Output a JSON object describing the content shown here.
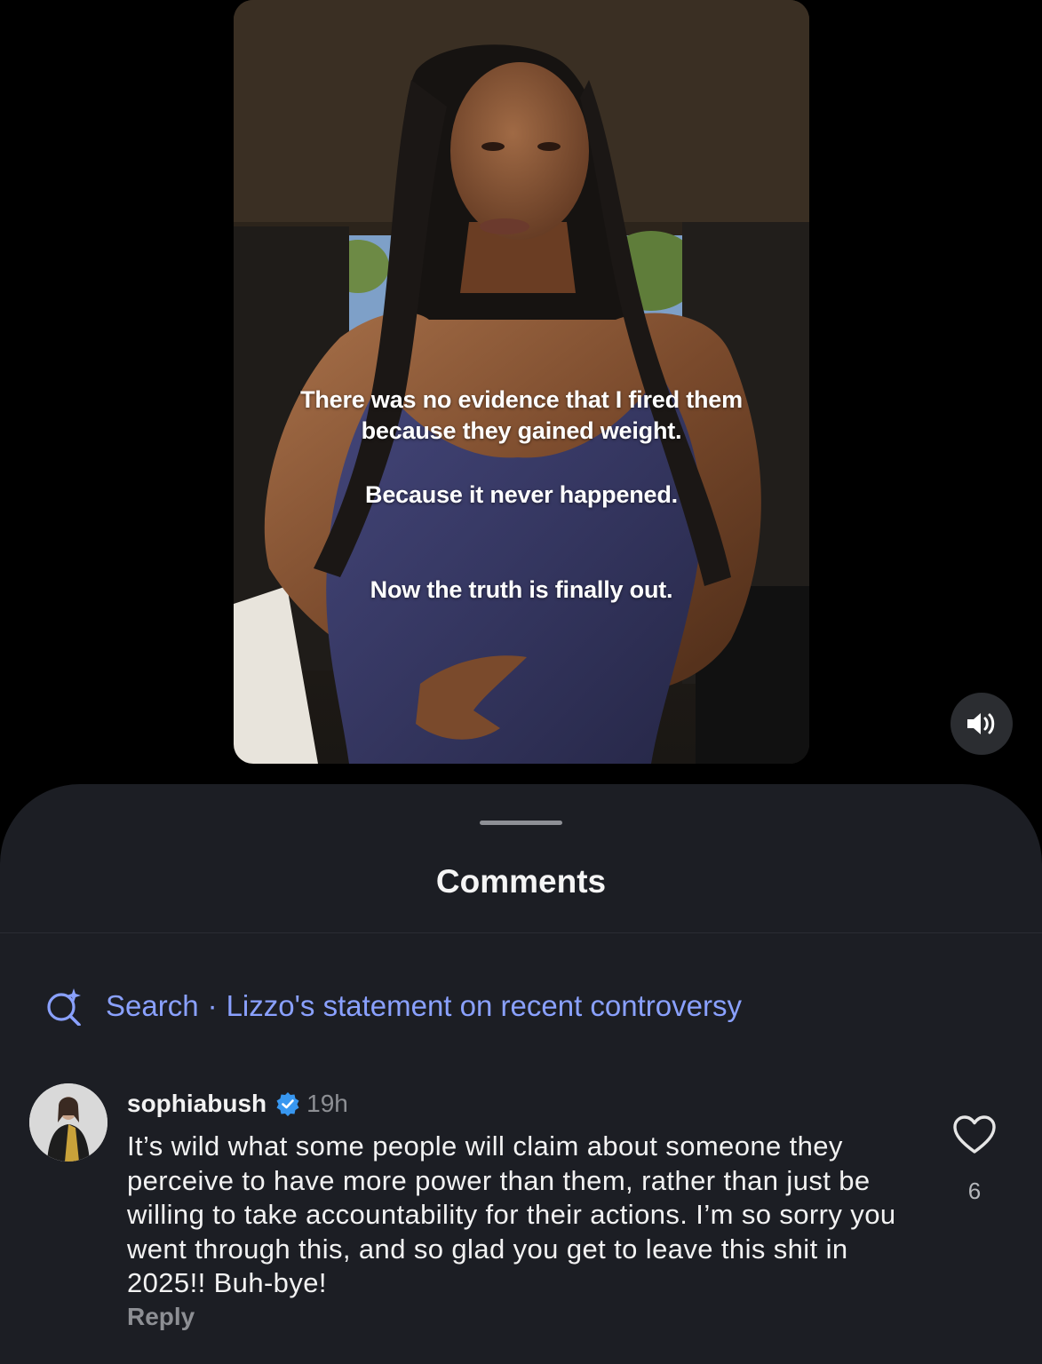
{
  "video": {
    "captions": {
      "line_1": "There was no evidence that I fired them",
      "line_2": "because they gained weight.",
      "line_3": "Because it never happened.",
      "line_4": "Now the truth is finally out."
    },
    "volume_icon": "speaker-on-icon"
  },
  "comments_sheet": {
    "title": "Comments",
    "search": {
      "icon": "search-sparkle-icon",
      "label": "Search",
      "separator": "·",
      "query": "Lizzo's statement on recent controversy"
    },
    "comment": {
      "username": "sophiabush",
      "verified": true,
      "timestamp": "19h",
      "text": "It’s wild what some people will claim about someone they perceive to have more power than them, rather than just be willing to take accountability for their actions. I’m so sorry you went through this, and so glad you get to leave this shit in 2025!! Buh-bye!",
      "reply_label": "Reply",
      "like_icon": "heart-outline-icon",
      "like_count": "6"
    }
  },
  "colors": {
    "background": "#000000",
    "sheet": "#1c1e24",
    "link_blue": "#8aa1ff",
    "verified_blue": "#3897f0",
    "muted_text": "#8d8f94"
  }
}
